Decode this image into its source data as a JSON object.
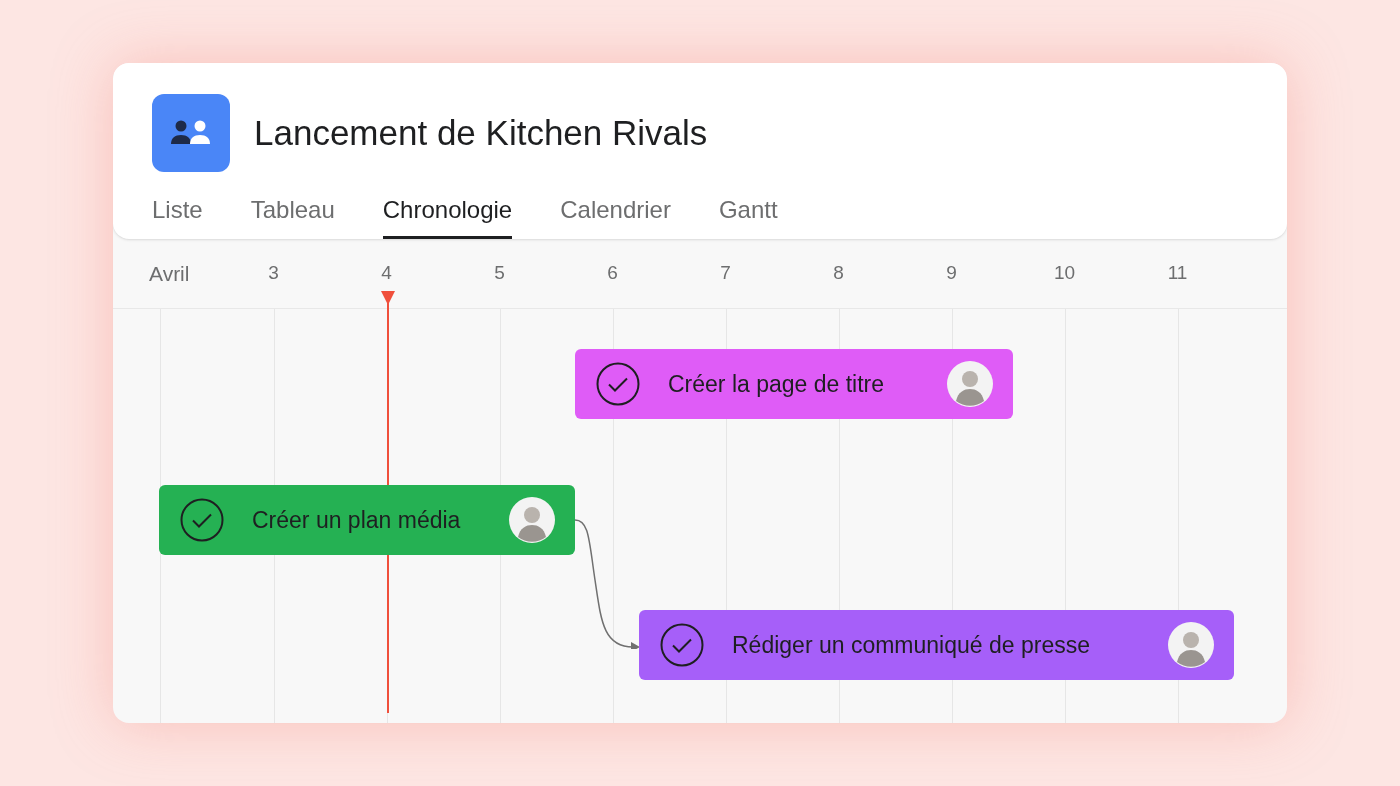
{
  "project": {
    "title": "Lancement de Kitchen Rivals"
  },
  "tabs": [
    {
      "label": "Liste",
      "selected": false
    },
    {
      "label": "Tableau",
      "selected": false
    },
    {
      "label": "Chronologie",
      "selected": true
    },
    {
      "label": "Calendrier",
      "selected": false
    },
    {
      "label": "Gantt",
      "selected": false
    }
  ],
  "timeline": {
    "month": "Avril",
    "days": [
      "3",
      "4",
      "5",
      "6",
      "7",
      "8",
      "9",
      "10",
      "11"
    ],
    "tasks": [
      {
        "name": "Créer la page de titre",
        "color": "#df5cf7"
      },
      {
        "name": "Créer un plan média",
        "color": "#25b153"
      },
      {
        "name": "Rédiger un communiqué de presse",
        "color": "#a65ff9"
      }
    ]
  }
}
